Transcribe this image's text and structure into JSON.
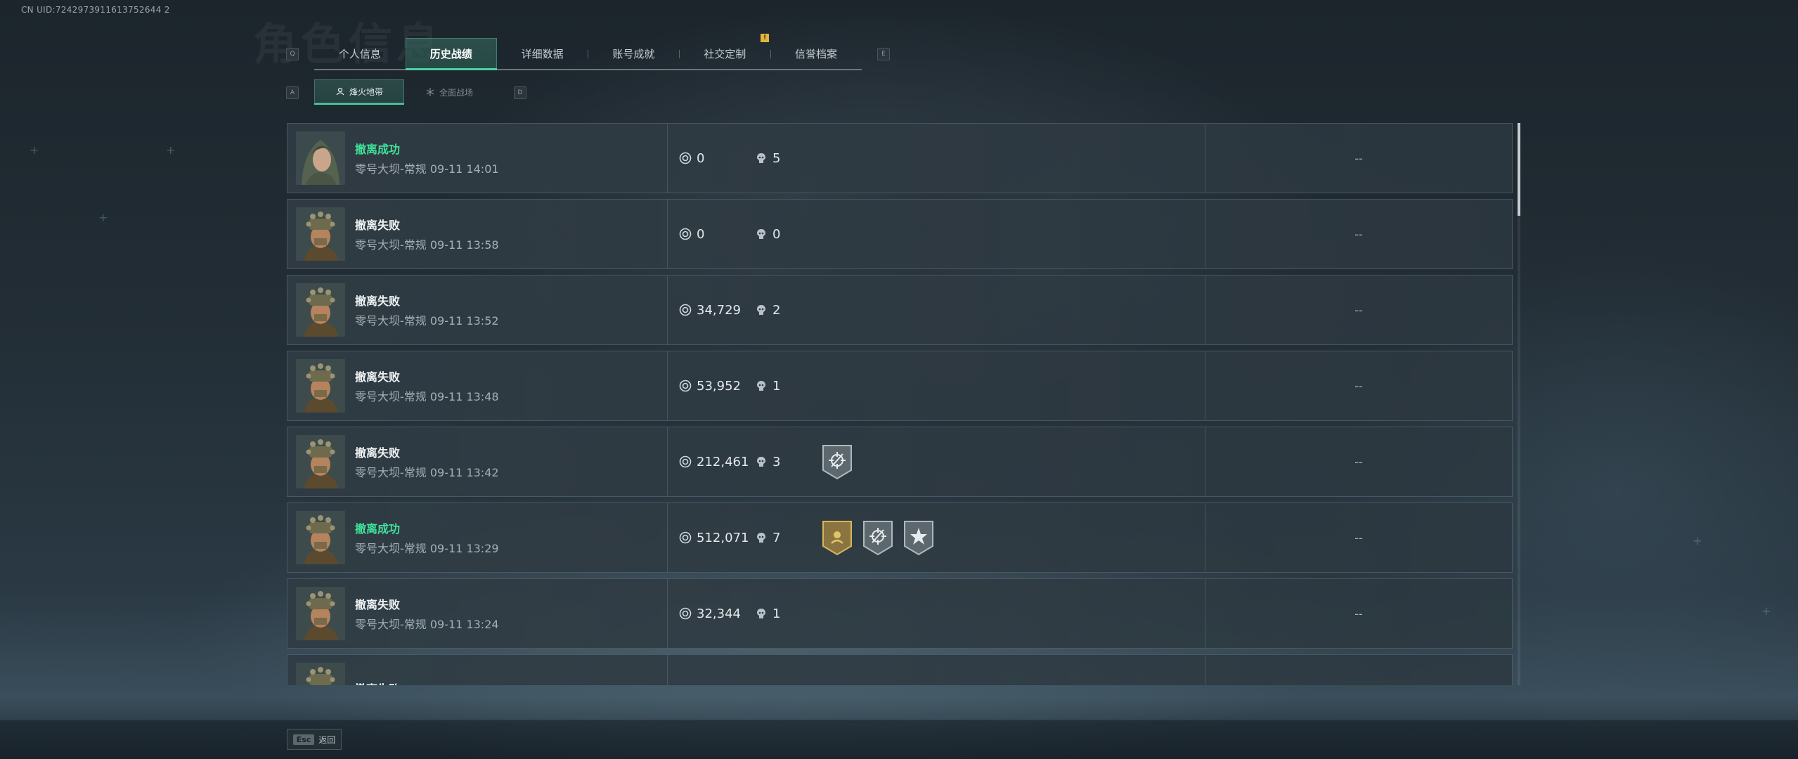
{
  "uid_text": "CN UID:7242973911613752644 2",
  "ghost_title": "角色信息",
  "key_hints": {
    "prev_tab": "Q",
    "next_tab": "E",
    "prev_subtab": "A",
    "next_subtab": "D"
  },
  "tabs": [
    {
      "label": "个人信息",
      "active": false
    },
    {
      "label": "历史战绩",
      "active": true
    },
    {
      "label": "详细数据",
      "active": false
    },
    {
      "label": "账号成就",
      "active": false
    },
    {
      "label": "社交定制",
      "active": false,
      "badge": "!"
    },
    {
      "label": "信誉档案",
      "active": false
    }
  ],
  "subtabs": [
    {
      "label": "烽火地带",
      "active": true,
      "icon": "mode-icon"
    },
    {
      "label": "全面战场",
      "active": false,
      "icon": "battlefield-icon"
    }
  ],
  "records": [
    {
      "status": "撤离成功",
      "success": true,
      "detail": "零号大坝-常规 09-11 14:01",
      "value": "0",
      "kills": "5",
      "badges": [],
      "extra": "--",
      "avatar": "operator-female"
    },
    {
      "status": "撤离失败",
      "success": false,
      "detail": "零号大坝-常规 09-11 13:58",
      "value": "0",
      "kills": "0",
      "badges": [],
      "extra": "--",
      "avatar": "operator-helmet"
    },
    {
      "status": "撤离失败",
      "success": false,
      "detail": "零号大坝-常规 09-11 13:52",
      "value": "34,729",
      "kills": "2",
      "badges": [],
      "extra": "--",
      "avatar": "operator-helmet"
    },
    {
      "status": "撤离失败",
      "success": false,
      "detail": "零号大坝-常规 09-11 13:48",
      "value": "53,952",
      "kills": "1",
      "badges": [],
      "extra": "--",
      "avatar": "operator-helmet"
    },
    {
      "status": "撤离失败",
      "success": false,
      "detail": "零号大坝-常规 09-11 13:42",
      "value": "212,461",
      "kills": "3",
      "badges": [
        "crosshair"
      ],
      "extra": "--",
      "avatar": "operator-helmet"
    },
    {
      "status": "撤离成功",
      "success": true,
      "detail": "零号大坝-常规 09-11 13:29",
      "value": "512,071",
      "kills": "7",
      "badges": [
        "gold-soldier",
        "crosshair",
        "star"
      ],
      "extra": "--",
      "avatar": "operator-helmet"
    },
    {
      "status": "撤离失败",
      "success": false,
      "detail": "零号大坝-常规 09-11 13:24",
      "value": "32,344",
      "kills": "1",
      "badges": [],
      "extra": "--",
      "avatar": "operator-helmet"
    },
    {
      "status": "撤离失败",
      "success": false,
      "detail": "",
      "value": "",
      "kills": "",
      "badges": [],
      "extra": "",
      "avatar": "operator-helmet"
    }
  ],
  "icons": {
    "value": "coin-icon",
    "kills": "skull-icon"
  },
  "colors": {
    "success": "#3fe29a",
    "accent": "#4fd0a3",
    "badge_gold": "#c9a24a"
  },
  "footer": {
    "esc_key": "Esc",
    "back_label": "返回"
  }
}
